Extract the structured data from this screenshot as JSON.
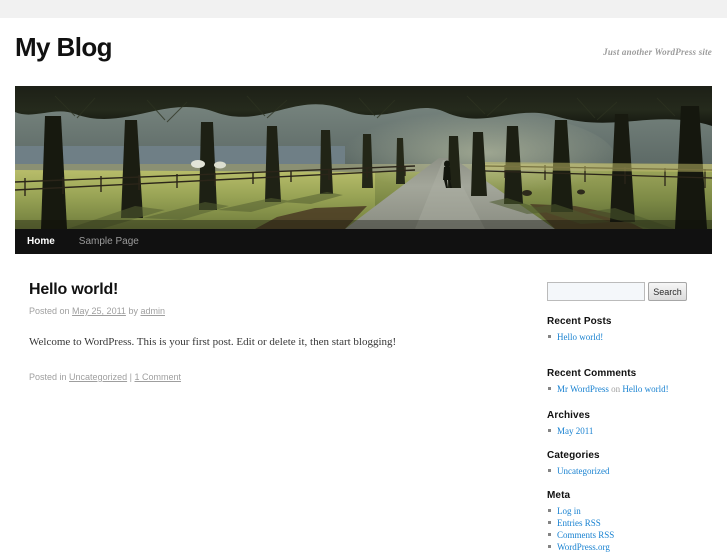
{
  "site": {
    "title": "My Blog",
    "description": "Just another WordPress site"
  },
  "nav": {
    "items": [
      {
        "label": "Home",
        "current": true
      },
      {
        "label": "Sample Page",
        "current": false
      }
    ]
  },
  "header_image": {
    "alt": "Avenue of bare trees with fence and gravel path"
  },
  "post": {
    "title": "Hello world!",
    "meta": {
      "posted_on_prefix": "Posted on",
      "date": "May 25, 2011",
      "by": "by",
      "author": "admin"
    },
    "content": "Welcome to WordPress. This is your first post. Edit or delete it, then start blogging!",
    "footer": {
      "posted_in_prefix": "Posted in",
      "category": "Uncategorized",
      "separator": "|",
      "comments": "1 Comment"
    }
  },
  "sidebar": {
    "search": {
      "value": "",
      "placeholder": "",
      "button_label": "Search"
    },
    "widgets": [
      {
        "title": "Recent Posts",
        "items": [
          {
            "label": "Hello world!"
          }
        ]
      },
      {
        "title": "Recent Comments",
        "items": [
          {
            "label": "Mr WordPress",
            "middle": " on ",
            "label2": "Hello world!"
          }
        ]
      },
      {
        "title": "Archives",
        "items": [
          {
            "label": "May 2011"
          }
        ]
      },
      {
        "title": "Categories",
        "items": [
          {
            "label": "Uncategorized"
          }
        ]
      },
      {
        "title": "Meta",
        "items": [
          {
            "label": "Log in"
          },
          {
            "label": "Entries RSS"
          },
          {
            "label": "Comments RSS"
          },
          {
            "label": "WordPress.org"
          }
        ]
      }
    ]
  },
  "colors": {
    "link": "#1982d1",
    "nav_background": "#111111",
    "top_band": "#f1f1f1",
    "meta_text": "#9f9f9f"
  }
}
